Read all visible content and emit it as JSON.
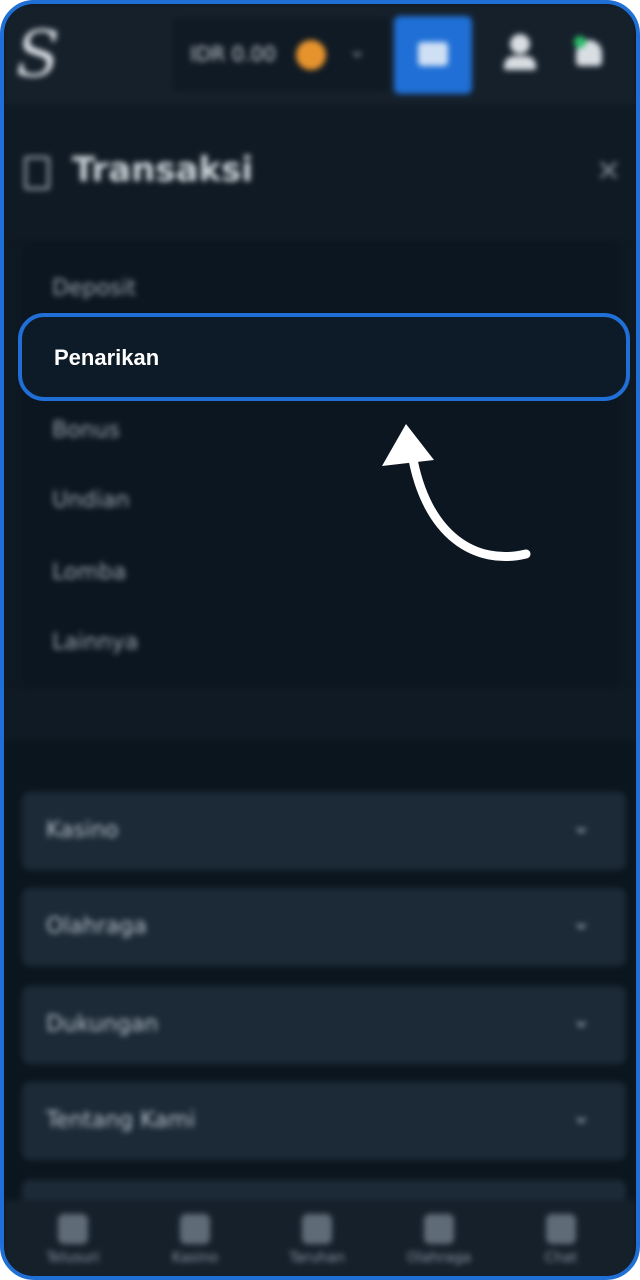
{
  "header": {
    "logo": "S",
    "balance": "IDR 0.00",
    "chevron": "⌄"
  },
  "panel": {
    "title": "Transaksi",
    "close": "✕"
  },
  "menu": {
    "items": [
      "Deposit",
      "Penarikan",
      "Bonus",
      "Undian",
      "Lomba",
      "Lainnya"
    ],
    "highlighted": "Penarikan"
  },
  "accordions": [
    {
      "label": "Kasino",
      "chevron": "⌄"
    },
    {
      "label": "Olahraga",
      "chevron": "⌄"
    },
    {
      "label": "Dukungan",
      "chevron": "⌄"
    },
    {
      "label": "Tentang Kami",
      "chevron": "⌄"
    }
  ],
  "bottom_nav": [
    "Telusuri",
    "Kasino",
    "Taruhan",
    "Olahraga",
    "Chat"
  ],
  "colors": {
    "accent": "#1f6fd6",
    "background": "#0f1923",
    "coin": "#e6932d"
  }
}
